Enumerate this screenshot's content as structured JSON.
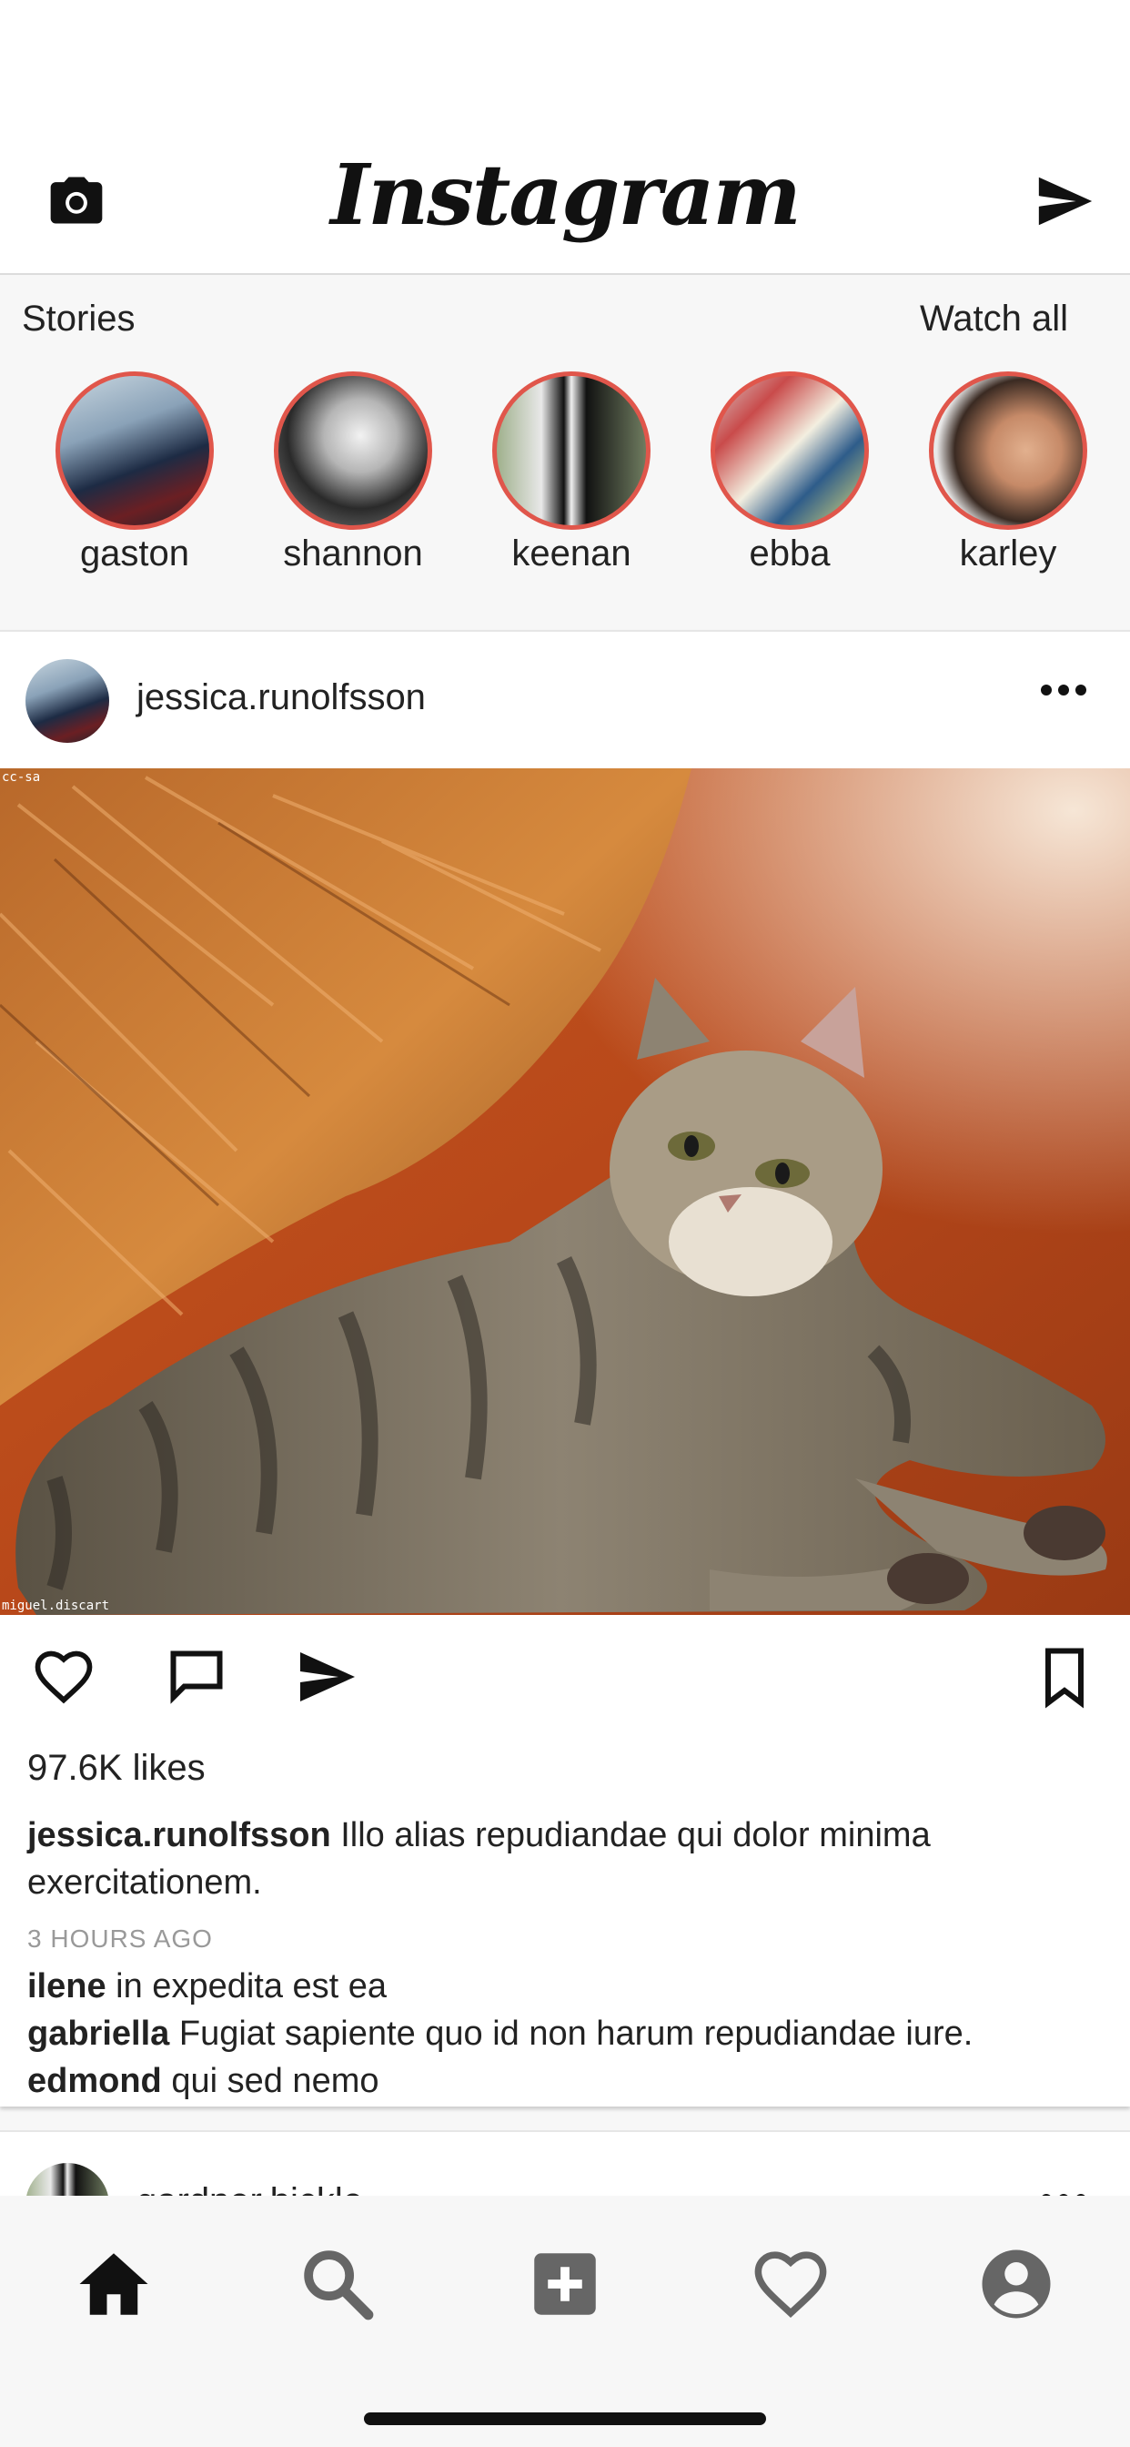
{
  "app": {
    "logo_text": "Instagram"
  },
  "header": {
    "camera_icon": "camera-icon",
    "send_icon": "send-icon"
  },
  "stories": {
    "title": "Stories",
    "watch_all": "Watch all",
    "ring_color": "#e0564b",
    "items": [
      {
        "name": "gaston"
      },
      {
        "name": "shannon"
      },
      {
        "name": "keenan"
      },
      {
        "name": "ebba"
      },
      {
        "name": "karley"
      }
    ]
  },
  "post": {
    "username": "jessica.runolfsson",
    "image_watermark_top": "cc-sa",
    "image_watermark_bottom": "miguel.discart",
    "likes": "97.6K likes",
    "caption_user": "jessica.runolfsson",
    "caption_text": "Illo alias repudiandae qui dolor minima exercitationem.",
    "time": "3 HOURS AGO",
    "comments": [
      {
        "user": "ilene",
        "text": "in expedita est ea"
      },
      {
        "user": "gabriella",
        "text": "Fugiat sapiente quo id non harum repudiandae iure."
      },
      {
        "user": "edmond",
        "text": "qui sed nemo"
      }
    ]
  },
  "next_post": {
    "username": "gardner.bickle"
  },
  "tabbar": {
    "items": [
      {
        "icon": "home-icon"
      },
      {
        "icon": "search-icon"
      },
      {
        "icon": "add-icon"
      },
      {
        "icon": "heart-icon"
      },
      {
        "icon": "profile-icon"
      }
    ]
  }
}
